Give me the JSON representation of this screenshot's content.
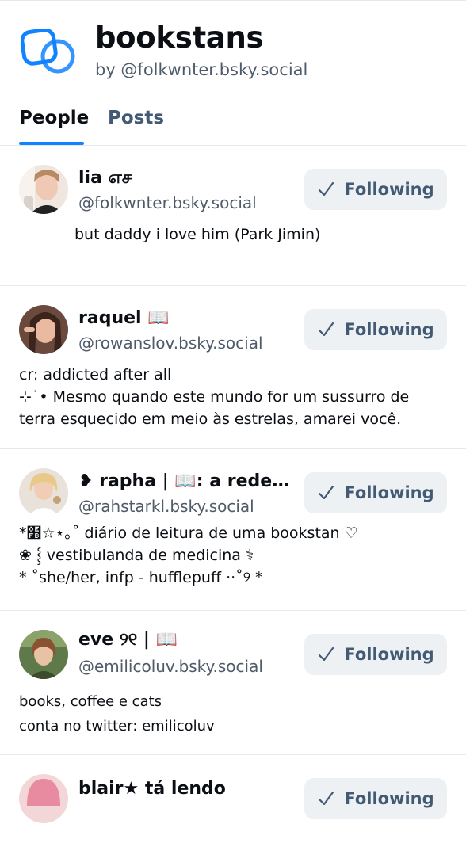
{
  "list": {
    "title": "bookstans",
    "byline": "by @folkwnter.bsky.social",
    "icon": "list-icon",
    "accent_color": "#1083fe"
  },
  "tabs": [
    {
      "label": "People",
      "active": true
    },
    {
      "label": "Posts",
      "active": false
    }
  ],
  "people": [
    {
      "name": "lia எச",
      "handle": "@folkwnter.bsky.social",
      "follow_label": "Following",
      "description": "but daddy i love him (Park Jimin)"
    },
    {
      "name": "raquel 📖",
      "handle": "@rowanslov.bsky.social",
      "follow_label": "Following",
      "description": "cr: addicted after all\n⊹˙• Mesmo quando este mundo for um sussurro de terra esquecido em meio às estrelas, amarei você."
    },
    {
      "name": "❥ rapha | 📖: a redenção",
      "handle": "@rahstarkl.bsky.social",
      "follow_label": "Following",
      "description": "*໻☆⋆｡˚ diário de leitura de uma bookstan ♡\n❀ ⸾ vestibulanda de medicina ⚕\n* ˚she/her, infp - hufflepuff ··˚୨ *"
    },
    {
      "name": "eve ୨୧ | 📖",
      "handle": "@emilicoluv.bsky.social",
      "follow_label": "Following",
      "description": "books, coffee e cats\nconta no twitter: emilicoluv"
    },
    {
      "name": "blair★ tá lendo",
      "handle": "",
      "follow_label": "Following",
      "description": ""
    }
  ]
}
